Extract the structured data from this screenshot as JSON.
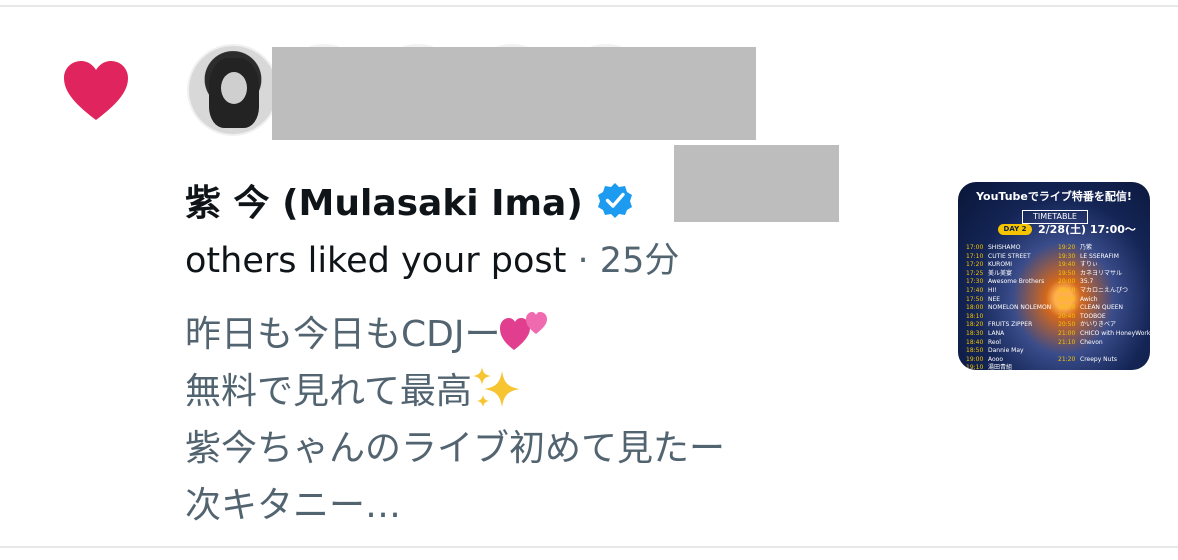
{
  "notification": {
    "type_icon": "heart-icon",
    "heart_color": "#e0245e",
    "user": {
      "display_name": "紫 今 (Mulasaki Ima)",
      "verified_icon": "verified-badge-icon",
      "verified_color": "#1d9bf0"
    },
    "action_text": "others liked your post",
    "separator": "·",
    "time_ago": "25分",
    "post_lines": [
      "昨日も今日もCDJー",
      "無料で見れて最高",
      "紫今ちゃんのライブ初めて見たー",
      "次キタニー…"
    ],
    "emoji_names": [
      "two-hearts-emoji",
      "sparkles-emoji"
    ]
  },
  "thumbnail": {
    "header": "YouTubeでライブ特番を配信!",
    "timetable_label": "TIMETABLE",
    "day_label": "DAY 2",
    "date": "2/28(土) 17:00〜",
    "left_column": [
      {
        "time": "17:00",
        "artist": "SHISHAMO"
      },
      {
        "time": "17:10",
        "artist": "CUTIE STREET"
      },
      {
        "time": "17:20",
        "artist": "KUROMI"
      },
      {
        "time": "17:25",
        "artist": "美ル美宴"
      },
      {
        "time": "17:30",
        "artist": "Awesome Brothers"
      },
      {
        "time": "17:40",
        "artist": "HI!"
      },
      {
        "time": "17:50",
        "artist": "NEE"
      },
      {
        "time": "18:00",
        "artist": "NOMELON NOLEMON"
      },
      {
        "time": "18:10",
        "artist": ""
      },
      {
        "time": "18:20",
        "artist": "FRUITS ZIPPER"
      },
      {
        "time": "18:30",
        "artist": "LANA"
      },
      {
        "time": "18:40",
        "artist": "Reol"
      },
      {
        "time": "18:50",
        "artist": "Dannie May"
      },
      {
        "time": "19:00",
        "artist": "Aooo"
      },
      {
        "time": "19:10",
        "artist": "湯田青組"
      }
    ],
    "right_column": [
      {
        "time": "19:20",
        "artist": "乃紫"
      },
      {
        "time": "19:30",
        "artist": "LE SSERAFIM"
      },
      {
        "time": "19:40",
        "artist": "すりぃ"
      },
      {
        "time": "19:50",
        "artist": "カネヨリマサル"
      },
      {
        "time": "20:00",
        "artist": "35.7"
      },
      {
        "time": "20:10",
        "artist": "マカロニえんぴつ"
      },
      {
        "time": "20:20",
        "artist": "Awich"
      },
      {
        "time": "20:30",
        "artist": "CLEAN QUEEN"
      },
      {
        "time": "20:40",
        "artist": "TOOBOE"
      },
      {
        "time": "20:50",
        "artist": "かいりきベア"
      },
      {
        "time": "21:00",
        "artist": "CHICO with HoneyWorks"
      },
      {
        "time": "21:10",
        "artist": "Chevon"
      },
      {
        "time": "",
        "artist": ""
      },
      {
        "time": "21:20",
        "artist": "Creepy Nuts"
      }
    ]
  }
}
